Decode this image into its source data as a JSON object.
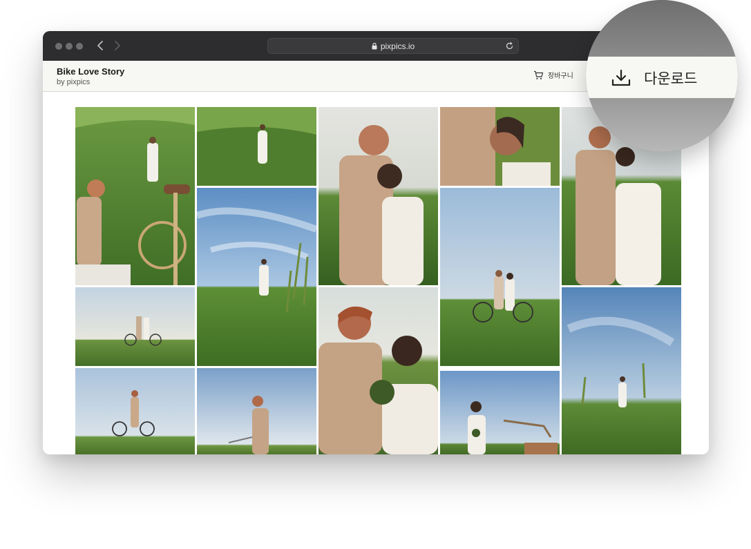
{
  "browser": {
    "url": "pixpics.io"
  },
  "header": {
    "title": "Bike Love Story",
    "subtitle": "by pixpics",
    "cart_label": "장바구니"
  },
  "zoom": {
    "download_label": "다운로드"
  },
  "gallery": {
    "photos": [
      "couple-bike-field",
      "woman-white-dress-field",
      "couple-embrace-sunset",
      "couple-closeup",
      "couple-standing-field",
      "woman-spinning-sky",
      "couple-with-bicycle",
      "couple-bike-horizon",
      "couple-face-to-face-flowers",
      "wide-sky-grass-woman",
      "man-with-bicycle",
      "man-walking-bicycle",
      "woman-bouquet-bicycle"
    ]
  }
}
